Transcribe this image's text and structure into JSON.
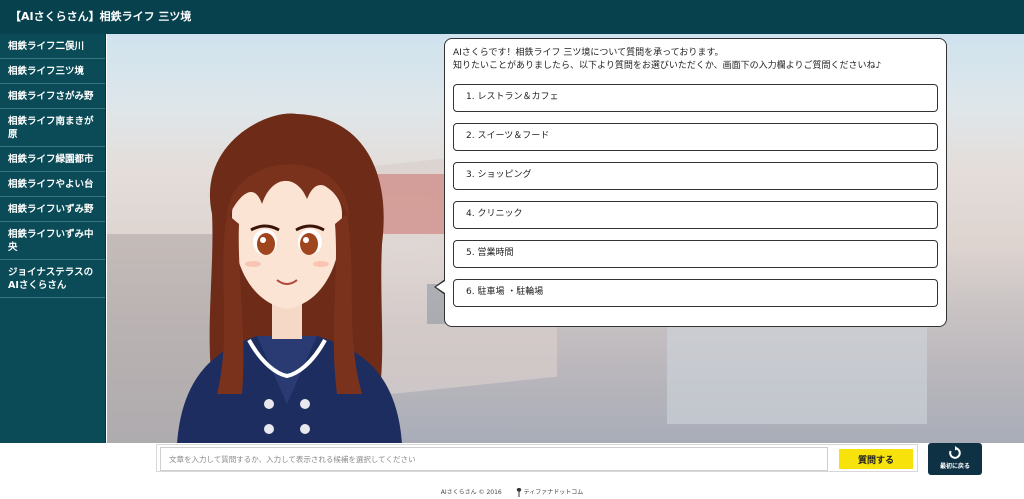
{
  "header": {
    "title": "【AIさくらさん】相鉄ライフ 三ツ境"
  },
  "sidebar": {
    "items": [
      {
        "label": "相鉄ライフ二俣川"
      },
      {
        "label": "相鉄ライフ三ツ境"
      },
      {
        "label": "相鉄ライフさがみ野"
      },
      {
        "label": "相鉄ライフ南まきが原"
      },
      {
        "label": "相鉄ライフ緑園都市"
      },
      {
        "label": "相鉄ライフやよい台"
      },
      {
        "label": "相鉄ライフいずみ野"
      },
      {
        "label": "相鉄ライフいずみ中央"
      },
      {
        "label": "ジョイナステラスのAIさくらさん"
      }
    ]
  },
  "bubble": {
    "intro_line1": "AIさくらです！相鉄ライフ 三ツ境について質問を承っております。",
    "intro_line2": "知りたいことがありましたら、以下より質問をお選びいただくか、画面下の入力欄よりご質問くださいね♪",
    "options": [
      {
        "label": "1. レストラン＆カフェ"
      },
      {
        "label": "2. スイーツ＆フード"
      },
      {
        "label": "3. ショッピング"
      },
      {
        "label": "4. クリニック"
      },
      {
        "label": "5. 営業時間"
      },
      {
        "label": "6. 駐車場 ・駐輪場"
      }
    ]
  },
  "input": {
    "value": "",
    "placeholder": "文章を入力して質問するか、入力して表示される候補を選択してください",
    "submit_label": "質問する"
  },
  "reset": {
    "label": "最初に戻る",
    "icon": "refresh-icon"
  },
  "footer": {
    "copyright": "AIさくらさん © 2016",
    "company": "ティファナドットコム",
    "icon": "plant-icon"
  },
  "colors": {
    "header_bg": "#07414e",
    "sidebar_bg": "#0a4b57",
    "accent_yellow": "#f7e20b",
    "reset_bg": "#0e3244"
  }
}
